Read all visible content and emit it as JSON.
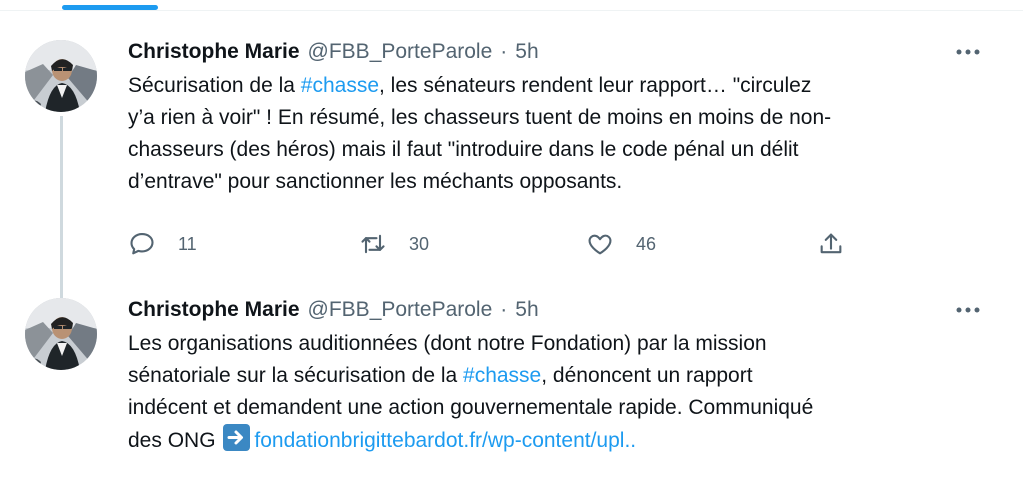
{
  "icons": {
    "avatar": "avatar-photo",
    "more": "more-horizontal-icon",
    "reply": "reply-icon",
    "retweet": "retweet-icon",
    "like": "like-icon",
    "share": "share-icon",
    "arrow": "right-arrow-emoji-icon"
  },
  "colors": {
    "accent": "#1d9bf0",
    "text": "#0f1419",
    "muted": "#536471",
    "thread_line": "#cfd9de"
  },
  "tweets": [
    {
      "author": "Christophe Marie",
      "handle": "@FBB_PorteParole",
      "separator": "·",
      "time": "5h",
      "body": {
        "line1_pre": "Sécurisation de la ",
        "line1_hashtag": "#chasse",
        "line1_post": ", les sénateurs rendent leur rapport… \"circulez",
        "line2": "y’a rien à voir\" ! En résumé, les chasseurs tuent de moins en moins de non-",
        "line3": "chasseurs (des héros) mais il faut \"introduire dans le code pénal un délit",
        "line4": "d’entrave\" pour sanctionner les méchants opposants."
      },
      "stats": {
        "replies": "11",
        "retweets": "30",
        "likes": "46"
      }
    },
    {
      "author": "Christophe Marie",
      "handle": "@FBB_PorteParole",
      "separator": "·",
      "time": "5h",
      "body": {
        "line1": "Les organisations auditionnées (dont notre Fondation) par la mission",
        "line2_pre": "sénatoriale sur la sécurisation de la ",
        "line2_hashtag": "#chasse",
        "line2_post": ", dénoncent un rapport",
        "line3": "indécent et demandent une action gouvernementale rapide. Communiqué",
        "line4_pre": "des ONG ",
        "line4_link": "fondationbrigittebardot.fr/wp-content/upl.."
      }
    }
  ]
}
